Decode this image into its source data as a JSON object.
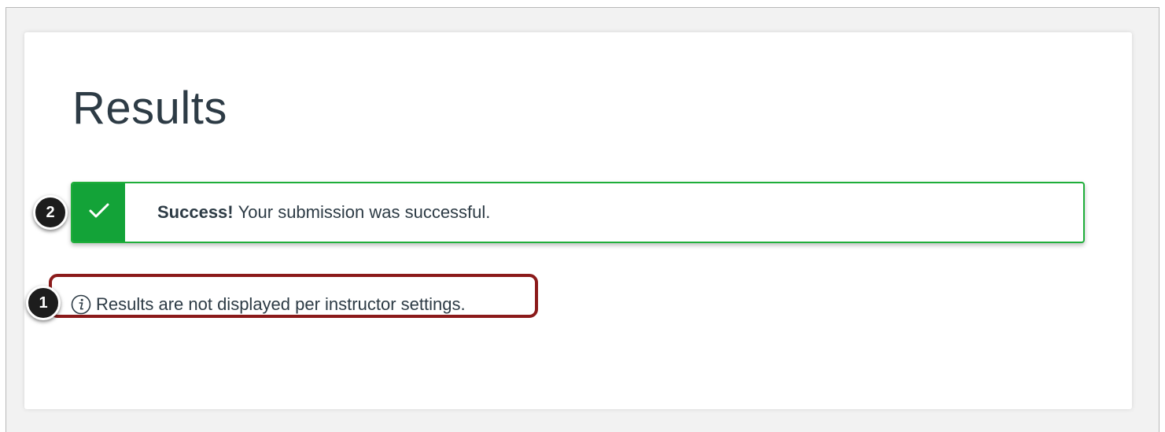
{
  "page": {
    "title": "Results"
  },
  "alert": {
    "type": "success",
    "icon": "checkmark-icon",
    "strong": "Success!",
    "message": "Your submission was successful.",
    "accent_color": "#13a338"
  },
  "info": {
    "icon": "info-icon",
    "text": "Results are not displayed per instructor settings."
  },
  "callouts": [
    {
      "label": "1",
      "target": "info-message"
    },
    {
      "label": "2",
      "target": "success-alert"
    }
  ],
  "colors": {
    "highlight": "#8b1a1a",
    "text": "#2d3b45",
    "success_border": "#1fae3a"
  }
}
